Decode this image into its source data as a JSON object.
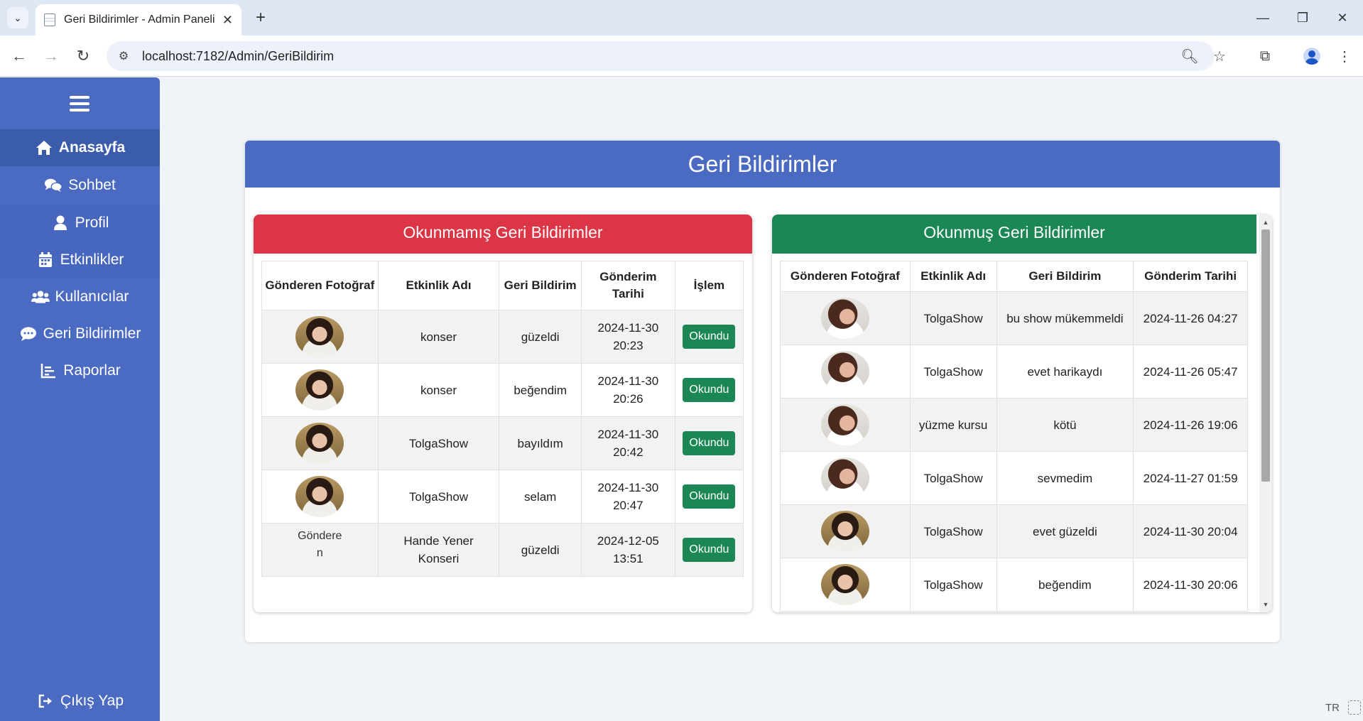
{
  "browser": {
    "tab_title": "Geri Bildirimler - Admin Paneli",
    "url": "localhost:7182/Admin/GeriBildirim"
  },
  "sidebar": {
    "items": [
      {
        "label": "Anasayfa",
        "icon": "home-icon"
      },
      {
        "label": "Sohbet",
        "icon": "chat-icon"
      },
      {
        "label": "Profil",
        "icon": "user-icon"
      },
      {
        "label": "Etkinlikler",
        "icon": "calendar-icon"
      },
      {
        "label": "Kullanıcılar",
        "icon": "users-icon"
      },
      {
        "label": "Geri Bildirimler",
        "icon": "comment-icon"
      },
      {
        "label": "Raporlar",
        "icon": "chart-icon"
      }
    ],
    "logout": "Çıkış Yap"
  },
  "page": {
    "title": "Geri Bildirimler"
  },
  "unread": {
    "title": "Okunmamış Geri Bildirimler",
    "headers": [
      "Gönderen Fotoğraf",
      "Etkinlik Adı",
      "Geri Bildirim",
      "Gönderim Tarihi",
      "İşlem"
    ],
    "button_label": "Okundu",
    "broken_img_alt": "Gönderen",
    "rows": [
      {
        "event": "konser",
        "feedback": "güzeldi",
        "date": "2024-11-30 20:23"
      },
      {
        "event": "konser",
        "feedback": "beğendim",
        "date": "2024-11-30 20:26"
      },
      {
        "event": "TolgaShow",
        "feedback": "bayıldım",
        "date": "2024-11-30 20:42"
      },
      {
        "event": "TolgaShow",
        "feedback": "selam",
        "date": "2024-11-30 20:47"
      },
      {
        "event": "Hande Yener Konseri",
        "feedback": "güzeldi",
        "date": "2024-12-05 13:51"
      }
    ]
  },
  "read": {
    "title": "Okunmuş Geri Bildirimler",
    "headers": [
      "Gönderen Fotoğraf",
      "Etkinlik Adı",
      "Geri Bildirim",
      "Gönderim Tarihi"
    ],
    "rows": [
      {
        "event": "TolgaShow",
        "feedback": "bu show mükemmeldi",
        "date": "2024-11-26 04:27"
      },
      {
        "event": "TolgaShow",
        "feedback": "evet harikaydı",
        "date": "2024-11-26 05:47"
      },
      {
        "event": "yüzme kursu",
        "feedback": "kötü",
        "date": "2024-11-26 19:06"
      },
      {
        "event": "TolgaShow",
        "feedback": "sevmedim",
        "date": "2024-11-27 01:59"
      },
      {
        "event": "TolgaShow",
        "feedback": "evet güzeldi",
        "date": "2024-11-30 20:04"
      },
      {
        "event": "TolgaShow",
        "feedback": "beğendim",
        "date": "2024-11-30 20:06"
      }
    ]
  },
  "status": {
    "language": "TR"
  }
}
